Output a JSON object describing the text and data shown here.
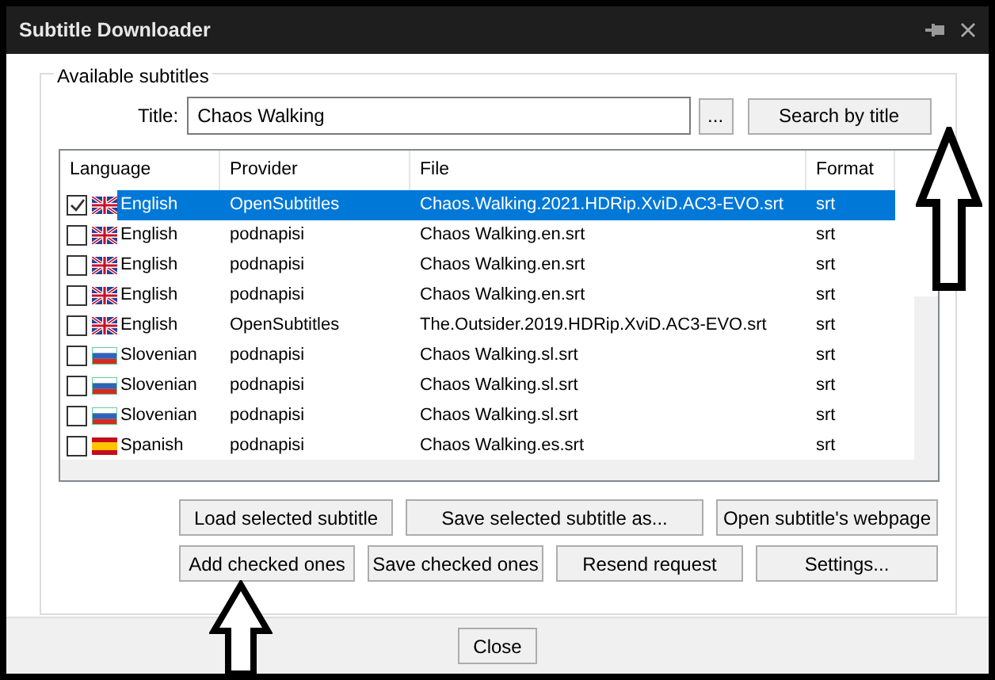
{
  "window": {
    "title": "Subtitle Downloader"
  },
  "group": {
    "label": "Available subtitles"
  },
  "title_field": {
    "label": "Title:",
    "value": "Chaos Walking",
    "browse": "..."
  },
  "search_button": "Search by title",
  "table": {
    "columns": [
      "Language",
      "Provider",
      "File",
      "Format"
    ],
    "rows": [
      {
        "checked": true,
        "selected": true,
        "kind": "gb",
        "language": "English",
        "provider": "OpenSubtitles",
        "file": "Chaos.Walking.2021.HDRip.XviD.AC3-EVO.srt",
        "format": "srt"
      },
      {
        "checked": false,
        "selected": false,
        "kind": "gb",
        "language": "English",
        "provider": "podnapisi",
        "file": "Chaos Walking.en.srt",
        "format": "srt"
      },
      {
        "checked": false,
        "selected": false,
        "kind": "gb",
        "language": "English",
        "provider": "podnapisi",
        "file": "Chaos Walking.en.srt",
        "format": "srt"
      },
      {
        "checked": false,
        "selected": false,
        "kind": "gb",
        "language": "English",
        "provider": "podnapisi",
        "file": "Chaos Walking.en.srt",
        "format": "srt"
      },
      {
        "checked": false,
        "selected": false,
        "kind": "gb",
        "language": "English",
        "provider": "OpenSubtitles",
        "file": "The.Outsider.2019.HDRip.XviD.AC3-EVO.srt",
        "format": "srt"
      },
      {
        "checked": false,
        "selected": false,
        "kind": "si",
        "language": "Slovenian",
        "provider": "podnapisi",
        "file": "Chaos Walking.sl.srt",
        "format": "srt"
      },
      {
        "checked": false,
        "selected": false,
        "kind": "si",
        "language": "Slovenian",
        "provider": "podnapisi",
        "file": "Chaos Walking.sl.srt",
        "format": "srt"
      },
      {
        "checked": false,
        "selected": false,
        "kind": "si",
        "language": "Slovenian",
        "provider": "podnapisi",
        "file": "Chaos Walking.sl.srt",
        "format": "srt"
      },
      {
        "checked": false,
        "selected": false,
        "kind": "es",
        "language": "Spanish",
        "provider": "podnapisi",
        "file": "Chaos Walking.es.srt",
        "format": "srt"
      }
    ]
  },
  "buttons_row_1": [
    "Load selected subtitle",
    "Save selected subtitle as...",
    "Open subtitle's webpage"
  ],
  "buttons_row_2": [
    "Add checked ones",
    "Save checked ones",
    "Resend request",
    "Settings..."
  ],
  "close_button": "Close"
}
